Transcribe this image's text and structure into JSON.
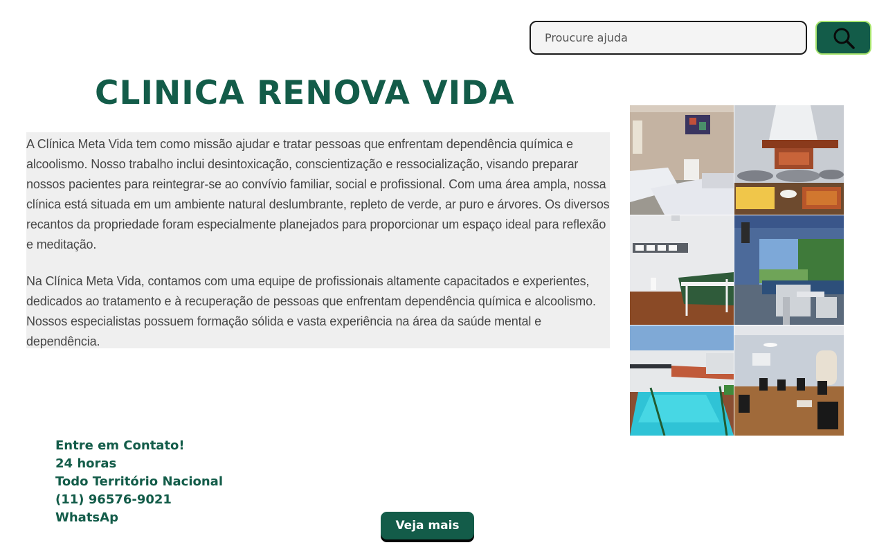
{
  "search": {
    "placeholder": "Proucure ajuda",
    "button_icon": "search-icon"
  },
  "header": {
    "title": "CLINICA RENOVA VIDA"
  },
  "about": {
    "paragraph1": "A Clínica Meta Vida tem como missão ajudar e tratar pessoas que enfrentam dependência química e alcoolismo. Nosso trabalho inclui desintoxicação, conscientização e ressocialização, visando preparar nossos pacientes para reintegrar-se ao convívio familiar, social e profissional. Com uma área ampla, nossa clínica está situada em um ambiente natural deslumbrante, repleto de verde, ar puro e árvores. Os diversos recantos da propriedade foram especialmente planejados para proporcionar um espaço ideal para reflexão e meditação.",
    "paragraph2": "Na Clínica Meta Vida, contamos com uma equipe de profissionais altamente capacitados e experientes, dedicados ao tratamento e à recuperação de pessoas que enfrentam dependência química e alcoolismo. Nossos especialistas possuem formação sólida e vasta experiência na área da saúde mental e dependência."
  },
  "contact": {
    "line1": "Entre em Contato!",
    "line2": "24 horas",
    "line3": "Todo Território Nacional",
    "line4": "(11) 96576-9021",
    "line5": "WhatsAp"
  },
  "cta": {
    "label": "Veja mais"
  },
  "colors": {
    "brand_green": "#135c49",
    "accent_lime": "#a6e36c",
    "panel_bg": "#efefef"
  }
}
